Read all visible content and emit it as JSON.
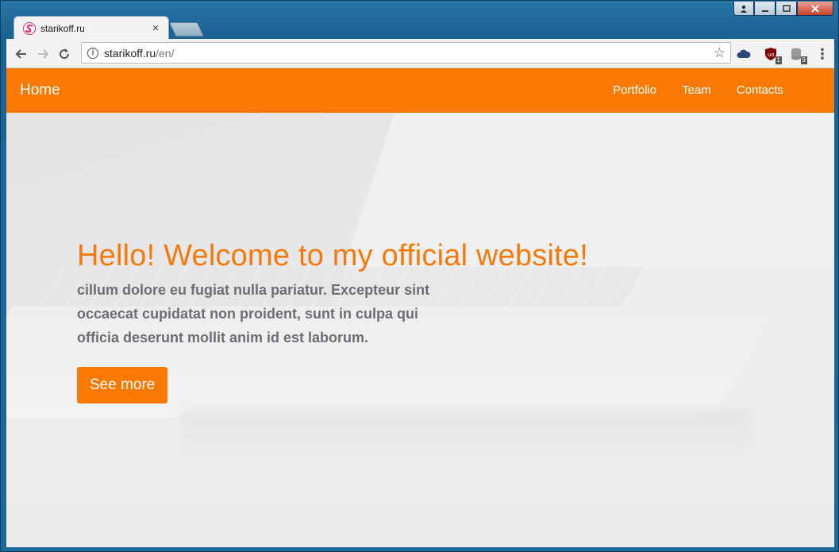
{
  "browser": {
    "tab": {
      "title": "starikoff.ru",
      "close_glyph": "×",
      "favicon": "s-logo-icon"
    },
    "address": {
      "host": "starikoff.ru",
      "path": "/en/"
    },
    "window_controls": {
      "minimize": "▁",
      "maximize": "▢",
      "close": "✕",
      "user": "👤"
    },
    "extensions": {
      "ublock_badge": "1",
      "db_badge": "9"
    }
  },
  "navbar": {
    "brand": "Home",
    "links": [
      "Portfolio",
      "Team",
      "Contacts"
    ],
    "color": "#fa7902"
  },
  "hero": {
    "heading": "Hello! Welcome to my official website!",
    "text": "cillum dolore eu fugiat nulla pariatur. Excepteur sint occaecat cupidatat non proident, sunt in culpa qui officia deserunt mollit anim id est laborum.",
    "button": "See more",
    "heading_color": "#f47a0c"
  }
}
